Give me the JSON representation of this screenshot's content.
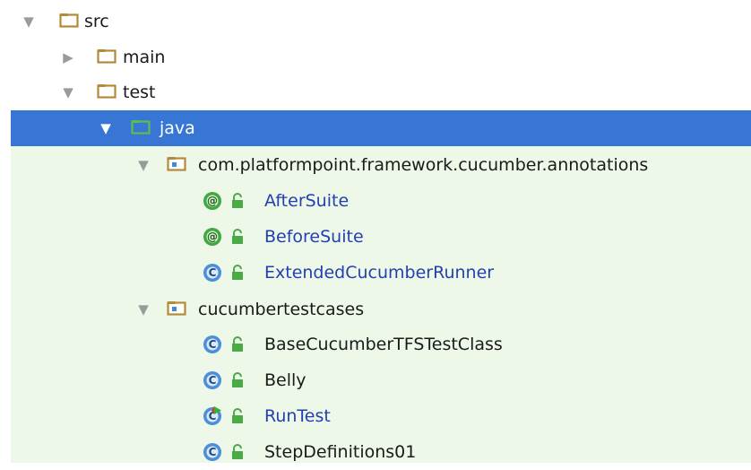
{
  "colors": {
    "selection": "#3876d5",
    "test_source_bg": "#eef8e8",
    "folder": "#b38a38",
    "test_folder": "#5bbf4a",
    "package_dot": "#3a8fd6",
    "annotation_badge": "#3fa83f",
    "class_badge": "#4a8fd8",
    "lock": "#4aaa44",
    "linked_text": "#2340b0"
  },
  "tree": {
    "src": {
      "label": "src",
      "icon": "folder-icon"
    },
    "main": {
      "label": "main",
      "icon": "folder-icon"
    },
    "test": {
      "label": "test",
      "icon": "folder-icon"
    },
    "java": {
      "label": "java",
      "icon": "test-source-folder-icon"
    },
    "pkg_annotations": {
      "label": "com.platformpoint.framework.cucumber.annotations",
      "icon": "package-icon",
      "items": [
        {
          "label": "AfterSuite",
          "badge": "@",
          "icon": "annotation-icon"
        },
        {
          "label": "BeforeSuite",
          "badge": "@",
          "icon": "annotation-icon"
        },
        {
          "label": "ExtendedCucumberRunner",
          "badge": "C",
          "icon": "class-icon"
        }
      ]
    },
    "pkg_testcases": {
      "label": "cucumbertestcases",
      "icon": "package-icon",
      "items": [
        {
          "label": "BaseCucumberTFSTestClass",
          "badge": "C",
          "icon": "class-icon"
        },
        {
          "label": "Belly",
          "badge": "C",
          "icon": "class-icon"
        },
        {
          "label": "RunTest",
          "badge": "C",
          "icon": "runnable-class-icon"
        },
        {
          "label": "StepDefinitions01",
          "badge": "C",
          "icon": "class-icon"
        }
      ]
    }
  }
}
